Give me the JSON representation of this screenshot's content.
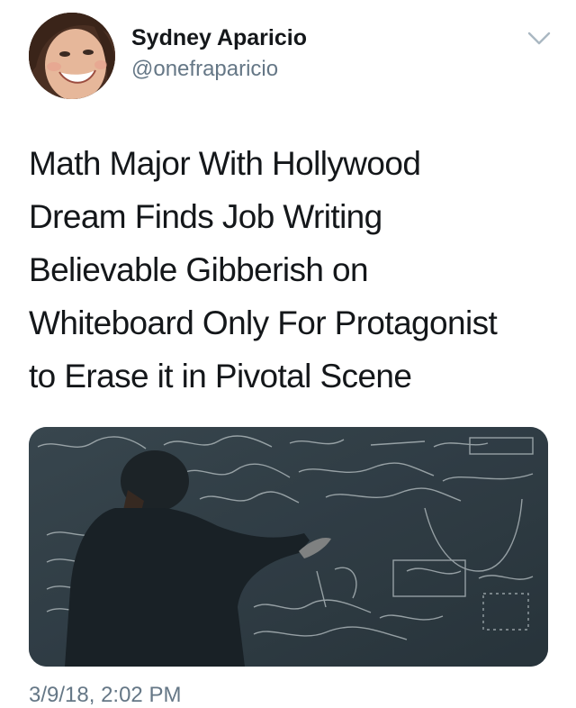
{
  "user": {
    "display_name": "Sydney Aparicio",
    "handle": "@onefraparicio"
  },
  "tweet": {
    "lines": [
      "Math Major With Hollywood",
      "Dream Finds Job Writing",
      "Believable Gibberish on",
      "Whiteboard Only For Protagonist",
      "to Erase it in Pivotal Scene"
    ],
    "timestamp": "3/9/18, 2:02 PM"
  },
  "icons": {
    "menu": "chevron-down-icon"
  },
  "colors": {
    "text_primary": "#14171a",
    "text_secondary": "#657786",
    "chevron": "#aab8c2"
  }
}
